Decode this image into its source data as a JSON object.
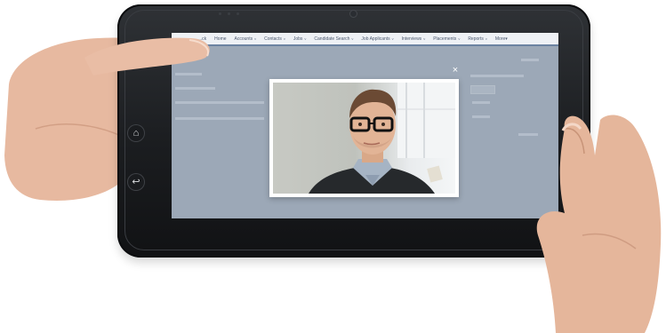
{
  "nav": {
    "items": [
      {
        "label": "...ck",
        "caret": ""
      },
      {
        "label": "Home",
        "caret": ""
      },
      {
        "label": "Accounts",
        "caret": "v"
      },
      {
        "label": "Contacts",
        "caret": "v"
      },
      {
        "label": "Jobs",
        "caret": "v"
      },
      {
        "label": "Candidate Search",
        "caret": "v"
      },
      {
        "label": "Job Applicants",
        "caret": "v"
      },
      {
        "label": "Interviews",
        "caret": "v"
      },
      {
        "label": "Placements",
        "caret": "v"
      },
      {
        "label": "Reports",
        "caret": "v"
      },
      {
        "label": "More▾",
        "caret": ""
      }
    ]
  },
  "modal": {
    "close_label": "×",
    "video_alt": "video of a man with glasses"
  },
  "colors": {
    "screen_overlay": "#9ca8b7",
    "nav_bg": "#eef1f5",
    "nav_accent": "#6c83a2"
  }
}
